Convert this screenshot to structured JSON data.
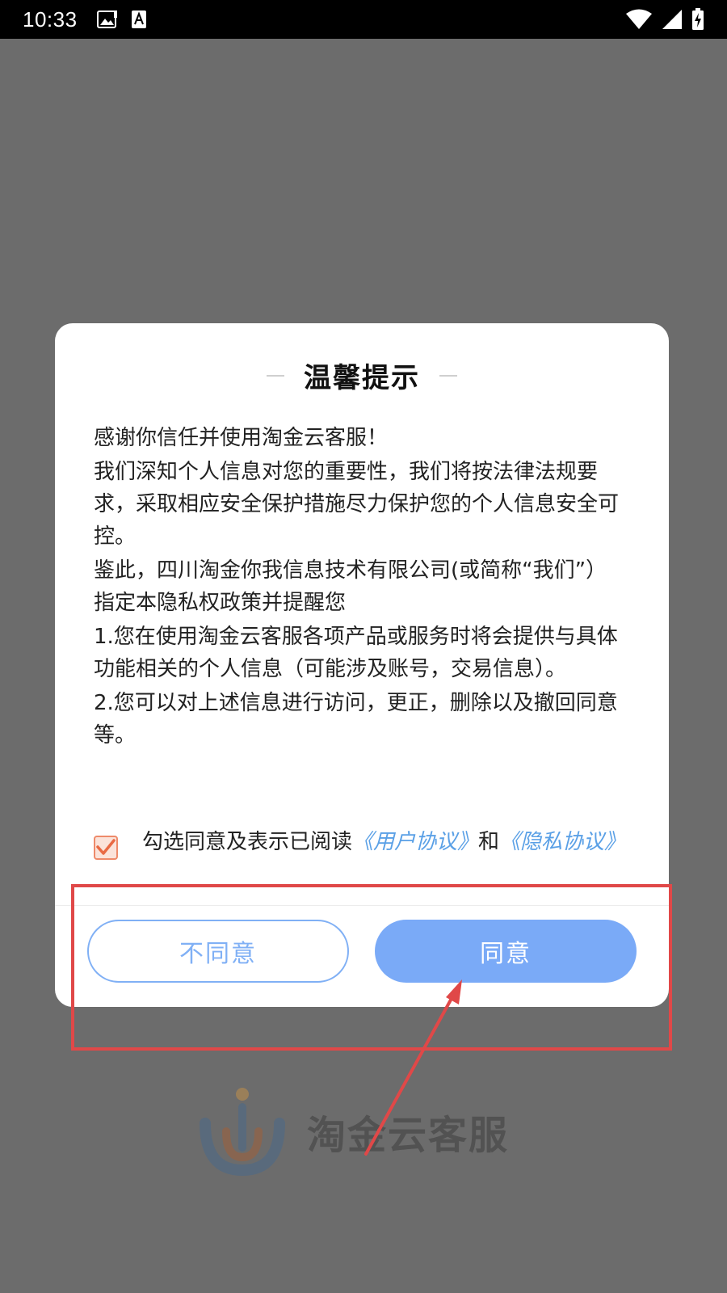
{
  "status_bar": {
    "time": "10:33",
    "left_icons": [
      "image-notification-icon",
      "accessibility-a-icon"
    ],
    "right_icons": [
      "wifi-icon",
      "signal-icon",
      "battery-charging-icon"
    ]
  },
  "background": {
    "logo_text": "淘金云客服"
  },
  "dialog": {
    "title": "温馨提示",
    "paragraphs": [
      "感谢你信任并使用淘金云客服！",
      "我们深知个人信息对您的重要性，我们将按法律法规要求，采取相应安全保护措施尽力保护您的个人信息安全可控。",
      "鉴此，四川淘金你我信息技术有限公司(或简称“我们”）指定本隐私权政策并提醒您",
      "1.您在使用淘金云客服各项产品或服务时将会提供与具体功能相关的个人信息（可能涉及账号，交易信息）。",
      "2.您可以对上述信息进行访问，更正，删除以及撤回同意等。"
    ],
    "agree": {
      "checked": true,
      "prefix": "勾选同意及表示已阅读",
      "user_agreement": "《用户协议》",
      "and": "和",
      "privacy_agreement": "《隐私协议》"
    },
    "buttons": {
      "disagree": "不同意",
      "agree": "同意"
    }
  },
  "colors": {
    "scrim": "#6c6c6c",
    "primary_button": "#7aaaf7",
    "link": "#5aa0e6",
    "annotation": "#e04848",
    "checkbox": "#ee8a6a"
  }
}
